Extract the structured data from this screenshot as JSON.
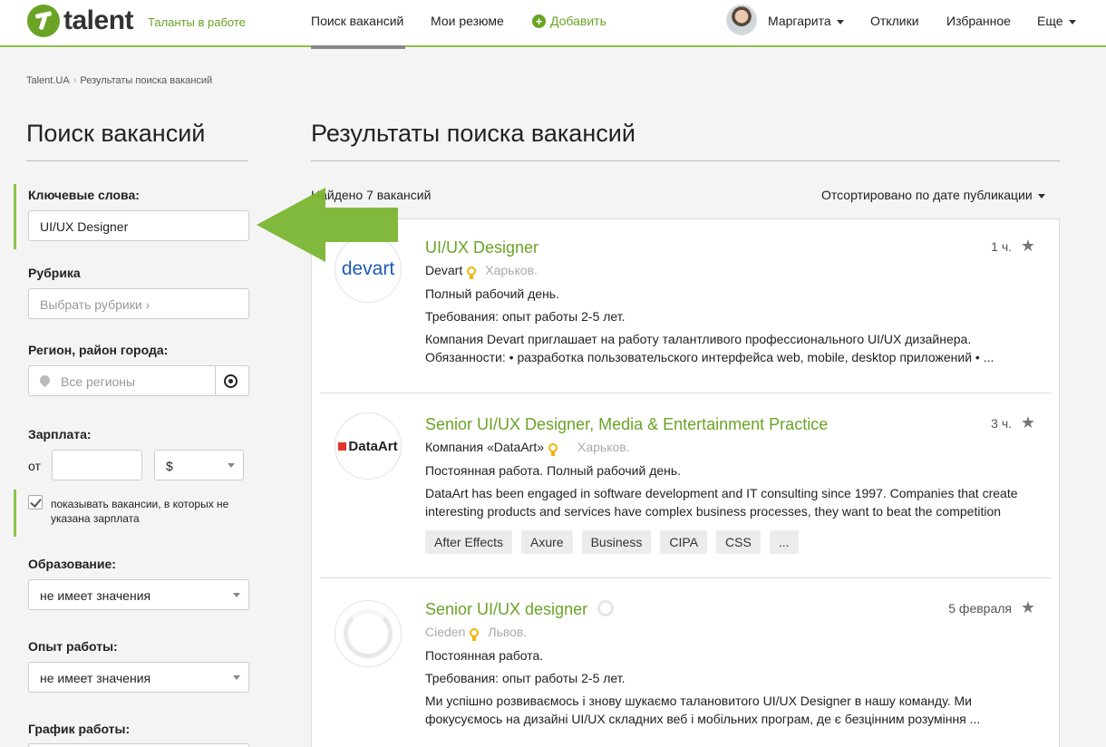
{
  "header": {
    "logo_text": "talent",
    "tagline": "Таланты в работе",
    "nav": {
      "search": "Поиск вакансий",
      "resumes": "Мои резюме",
      "add": "Добавить",
      "user": "Маргарита",
      "responses": "Отклики",
      "favorites": "Избранное",
      "more": "Еще"
    },
    "accent_color": "#6aa325"
  },
  "breadcrumb": [
    "Talent.UA",
    "Результаты поиска вакансий"
  ],
  "sidebar": {
    "title": "Поиск вакансий",
    "keywords_label": "Ключевые слова:",
    "keywords_value": "UI/UX Designer",
    "rubric_label": "Рубрика",
    "rubric_placeholder": "Выбрать рубрики ›",
    "region_label": "Регион, район города:",
    "region_placeholder": "Все регионы",
    "salary_label": "Зарплата:",
    "salary_from": "от",
    "currency": "$",
    "show_no_salary": "показывать вакансии, в которых не указана зарплата",
    "education_label": "Образование:",
    "education_value": "не имеет значения",
    "experience_label": "Опыт работы:",
    "experience_value": "не имеет значения",
    "schedule_label": "График работы:"
  },
  "main": {
    "title": "Результаты поиска вакансий",
    "found": "Найдено 7 вакансий",
    "sort": "Отсортировано по дате публикации",
    "vacancies": [
      {
        "logo": "devart",
        "title": "UI/UX Designer",
        "company": "Devart",
        "city": "Харьков.",
        "time": "1 ч.",
        "line1": "Полный рабочий день.",
        "line2": "Требования: опыт работы 2-5 лет.",
        "desc": "Компания Devart приглашает на работу талантливого профессионального UI/UX дизайнера. Обязанности: • разработка пользовательского интерфейса web, mobile, desktop приложений • ..."
      },
      {
        "logo": "DataArt",
        "title": "Senior UI/UX Designer, Media & Entertainment Practice",
        "company": "Компания «DataArt»",
        "city": "Харьков.",
        "time": "3 ч.",
        "line1": "Постоянная работа. Полный рабочий день.",
        "desc": "DataArt has been engaged in software development and IT consulting since 1997. Companies that create interesting products and services have complex business processes, they want to beat the competition",
        "tags": [
          "After Effects",
          "Axure",
          "Business",
          "CIPA",
          "CSS",
          "..."
        ]
      },
      {
        "title": "Senior UI/UX designer",
        "company": "Cieden",
        "city": "Львов.",
        "time": "5 февраля",
        "line1": "Постоянная работа.",
        "line2": "Требования: опыт работы 2-5 лет.",
        "desc": "Ми успішно розвиваємось і знову шукаємо таланов​итого UI/UX Designer в нашу команду. Ми фокусуємось на дизайні UI/UX складних веб і мобільних програм, де є безцінним розуміння ..."
      }
    ]
  }
}
